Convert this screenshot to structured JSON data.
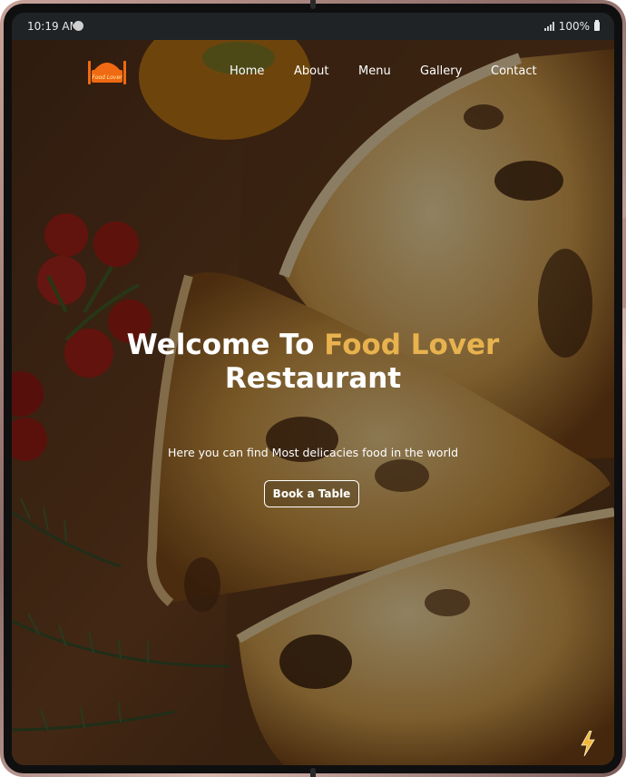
{
  "status_bar": {
    "time": "10:19 AM",
    "battery": "100%"
  },
  "logo": {
    "text": "Food Lover"
  },
  "nav": {
    "items": [
      "Home",
      "About",
      "Menu",
      "Gallery",
      "Contact"
    ]
  },
  "hero": {
    "headline_part1": "Welcome To ",
    "headline_accent": "Food Lover",
    "headline_part2": "Restaurant",
    "subtitle": "Here you can find Most delicacies food in the world",
    "button_label": "Book a Table"
  },
  "colors": {
    "accent": "#e8b24e",
    "logo_orange": "#f06a14",
    "statusbar": "#1f2326"
  }
}
